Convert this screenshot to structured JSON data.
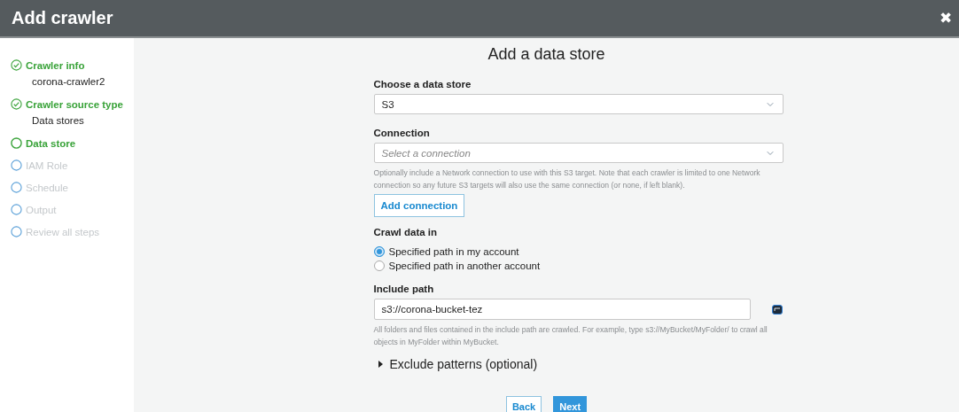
{
  "window": {
    "title": "Add crawler",
    "close": "✖"
  },
  "steps": [
    {
      "label": "Crawler info",
      "completed": true,
      "active": false,
      "detail": "corona-crawler2"
    },
    {
      "label": "Crawler source type",
      "completed": true,
      "active": false,
      "detail": "Data stores"
    },
    {
      "label": "Data store",
      "completed": false,
      "active": true
    },
    {
      "label": "IAM Role",
      "completed": false,
      "active": false
    },
    {
      "label": "Schedule",
      "completed": false,
      "active": false
    },
    {
      "label": "Output",
      "completed": false,
      "active": false
    },
    {
      "label": "Review all steps",
      "completed": false,
      "active": false
    }
  ],
  "form": {
    "heading": "Add a data store",
    "data_store": {
      "label": "Choose a data store",
      "value": "S3"
    },
    "connection": {
      "label": "Connection",
      "placeholder": "Select a connection",
      "help": "Optionally include a Network connection to use with this S3 target. Note that each crawler is limited to one Network connection so any future S3 targets will also use the same connection (or none, if left blank).",
      "button": "Add connection"
    },
    "crawl_data_in": {
      "label": "Crawl data in",
      "options": [
        {
          "label": "Specified path in my account",
          "selected": true
        },
        {
          "label": "Specified path in another account",
          "selected": false
        }
      ]
    },
    "include_path": {
      "label": "Include path",
      "value": "s3://corona-bucket-tez",
      "help": "All folders and files contained in the include path are crawled. For example, type s3://MyBucket/MyFolder/ to crawl all objects in MyFolder within MyBucket."
    },
    "exclude": {
      "label": "Exclude patterns (optional)",
      "expanded": false
    }
  },
  "buttons": [
    {
      "label": "Back",
      "kind": "secondary"
    },
    {
      "label": "Next",
      "kind": "primary"
    }
  ]
}
